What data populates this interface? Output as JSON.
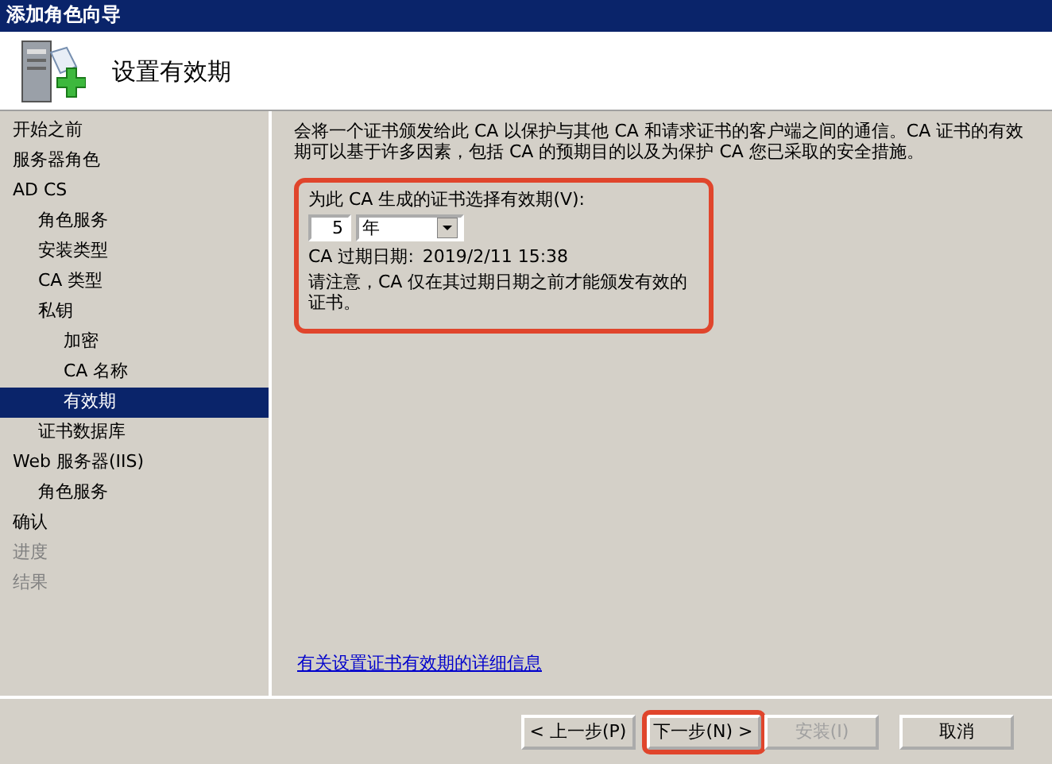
{
  "window": {
    "title": "添加角色向导"
  },
  "header": {
    "title": "设置有效期"
  },
  "sidebar": {
    "items": [
      {
        "label": "开始之前",
        "selected": false,
        "disabled": false
      },
      {
        "label": "服务器角色",
        "selected": false,
        "disabled": false
      },
      {
        "label": "AD CS",
        "selected": false,
        "disabled": false,
        "children": [
          {
            "label": "角色服务",
            "selected": false,
            "disabled": false
          },
          {
            "label": "安装类型",
            "selected": false,
            "disabled": false
          },
          {
            "label": "CA 类型",
            "selected": false,
            "disabled": false
          },
          {
            "label": "私钥",
            "selected": false,
            "disabled": false,
            "children": [
              {
                "label": "加密",
                "selected": false,
                "disabled": false
              },
              {
                "label": "CA 名称",
                "selected": false,
                "disabled": false
              },
              {
                "label": "有效期",
                "selected": true,
                "disabled": false
              }
            ]
          },
          {
            "label": "证书数据库",
            "selected": false,
            "disabled": false
          }
        ]
      },
      {
        "label": "Web 服务器(IIS)",
        "selected": false,
        "disabled": false,
        "children": [
          {
            "label": "角色服务",
            "selected": false,
            "disabled": false
          }
        ]
      },
      {
        "label": "确认",
        "selected": false,
        "disabled": false
      },
      {
        "label": "进度",
        "selected": false,
        "disabled": true
      },
      {
        "label": "结果",
        "selected": false,
        "disabled": true
      }
    ]
  },
  "content": {
    "intro": "会将一个证书颁发给此 CA 以保护与其他 CA 和请求证书的客户端之间的通信。CA 证书的有效期可以基于许多因素，包括 CA 的预期目的以及为保护 CA 您已采取的安全措施。",
    "validity": {
      "highlighted": true,
      "label": "为此 CA 生成的证书选择有效期(V):",
      "value": "5",
      "unit": "年",
      "expiry_label": "CA 过期日期:",
      "expiry": "2019/2/11 15:38",
      "note": "请注意，CA 仅在其过期日期之前才能颁发有效的证书。"
    },
    "link": "有关设置证书有效期的详细信息"
  },
  "buttons": [
    {
      "label": "< 上一步(P)",
      "disabled": false,
      "highlighted": false
    },
    {
      "label": "下一步(N) >",
      "disabled": false,
      "highlighted": true
    },
    {
      "label": "安装(I)",
      "disabled": true,
      "highlighted": false
    },
    {
      "label": "取消",
      "disabled": false,
      "highlighted": false
    }
  ]
}
